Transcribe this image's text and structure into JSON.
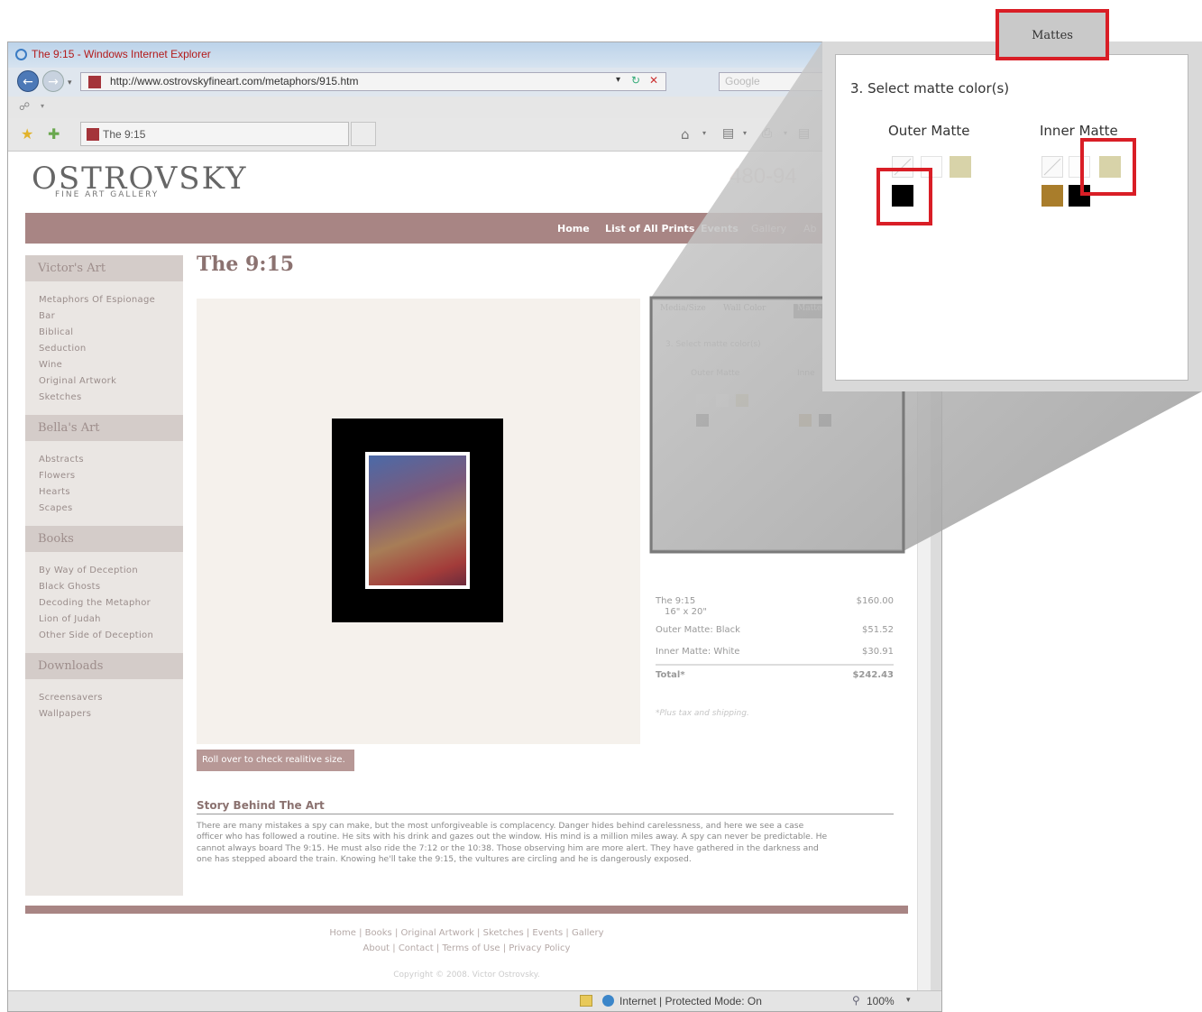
{
  "browser": {
    "window_title": "The 9:15 - Windows Internet Explorer",
    "address": "http://www.ostrovskyfineart.com/metaphors/915.htm",
    "search_placeholder": "Google",
    "tab_title": "The 9:15",
    "status_zone": "Internet | Protected Mode: On",
    "zoom": "100%"
  },
  "site": {
    "logo": "OSTROVSKY",
    "logo_sub": "FINE ART GALLERY",
    "phone": "480-94",
    "nav": [
      "Home",
      "List of All Prints",
      "Events",
      "Gallery",
      "Ab"
    ]
  },
  "sidebar": {
    "sections": [
      {
        "title": "Victor's Art",
        "items": [
          "Metaphors Of Espionage",
          "Bar",
          "Biblical",
          "Seduction",
          "Wine",
          "Original Artwork",
          "Sketches"
        ]
      },
      {
        "title": "Bella's Art",
        "items": [
          "Abstracts",
          "Flowers",
          "Hearts",
          "Scapes"
        ]
      },
      {
        "title": "Books",
        "items": [
          "By Way of Deception",
          "Black Ghosts",
          "Decoding the Metaphor",
          "Lion of Judah",
          "Other Side of Deception"
        ]
      },
      {
        "title": "Downloads",
        "items": [
          "Screensavers",
          "Wallpapers"
        ]
      }
    ]
  },
  "product": {
    "title": "The 9:15",
    "rollover_label": "Roll over to check realitive size.",
    "option_tabs": [
      "Media/Size",
      "Wall Color",
      "Matte"
    ],
    "options_step": "3. Select matte color(s)",
    "outer_label": "Outer Matte",
    "inner_label": "Inne",
    "price_lines": [
      {
        "label": "The 9:15",
        "sub": "16\" x 20\"",
        "value": "$160.00"
      },
      {
        "label": "Outer Matte: Black",
        "value": "$51.52"
      },
      {
        "label": "Inner Matte: White",
        "value": "$30.91"
      }
    ],
    "total_label": "Total*",
    "total_value": "$242.43",
    "tax_note": "*Plus tax and shipping."
  },
  "story": {
    "heading": "Story Behind The Art",
    "body": "There are many mistakes a spy can make, but the most unforgiveable is complacency. Danger hides behind carelessness, and here we see a case officer who has followed a routine. He sits with his drink and gazes out the window. His mind is a million miles away. A spy can never be predictable. He cannot always board The 9:15. He must also ride the 7:12 or the 10:38. Those observing him are more alert. They have gathered in the darkness and one has stepped aboard the train. Knowing he'll take the 9:15, the vultures are circling and he is dangerously exposed."
  },
  "footer": {
    "links_row1": "Home | Books | Original Artwork | Sketches | Events | Gallery",
    "links_row2": "About | Contact | Terms of Use | Privacy Policy",
    "copyright": "Copyright © 2008. Victor Ostrovsky."
  },
  "zoom": {
    "tab_label": "Mattes",
    "step": "3. Select matte color(s)",
    "outer_label": "Outer Matte",
    "inner_label": "Inner Matte"
  },
  "colors": {
    "highlight": "#d91e26",
    "brand": "#a88584",
    "swatch_black": "#000000",
    "swatch_beige": "#d8d3a9",
    "swatch_gold": "#a97d2b"
  }
}
